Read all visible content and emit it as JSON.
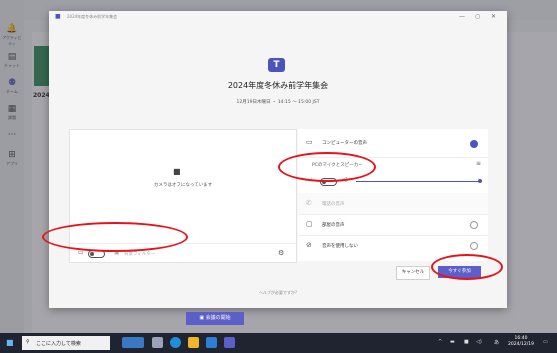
{
  "rail": [
    {
      "icon": "activity-icon",
      "glyph": "🔔",
      "label": "アクティビティ"
    },
    {
      "icon": "chat-icon",
      "glyph": "▤",
      "label": "チャット"
    },
    {
      "icon": "teams-icon",
      "glyph": "⚉",
      "label": "チーム"
    },
    {
      "icon": "assignments-icon",
      "glyph": "▦",
      "label": "課題"
    },
    {
      "icon": "more-icon",
      "glyph": "···",
      "label": ""
    },
    {
      "icon": "apps-icon",
      "glyph": "⊞",
      "label": "アプリ"
    }
  ],
  "background": {
    "year_text": "2024"
  },
  "dialog": {
    "window_title": "2024年度冬休み前学年集会",
    "meeting_title": "2024年度冬休み前学年集会",
    "meeting_time": "12月19日木曜日 ・ 14:15 ～ 15:00 JST",
    "camera_off_text": "カメラはオフになっています",
    "background_filter_label": "背景フィルター",
    "audio_options": [
      {
        "label": "コンピューターの音声",
        "selected": true
      },
      {
        "label": "PCのマイクとスピーカー"
      },
      {
        "label": "電話の音声"
      },
      {
        "label": "部屋の音声"
      },
      {
        "label": "音声を使用しない"
      }
    ],
    "cancel_label": "キャンセル",
    "join_label": "今すぐ参加",
    "footer_text": "ヘルプが必要ですか?"
  },
  "start_meeting_label": "会議の開始",
  "taskbar": {
    "search_placeholder": "ここに入力して検索",
    "time": "16:40",
    "date": "2024/12/19"
  },
  "colors": {
    "accent": "#5b5fc7",
    "annotation": "#e8121c"
  }
}
